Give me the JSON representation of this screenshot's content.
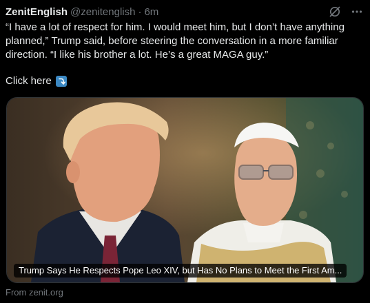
{
  "tweet": {
    "author_name": "ZenitEnglish",
    "handle": "@zenitenglish",
    "separator": "·",
    "time": "6m",
    "text": "“I have a lot of respect for him. I would meet him, but I don’t have anything planned,” Trump said, before steering the conversation in a more familiar direction. “I like his brother a lot. He’s a great MAGA guy.”",
    "link_text": "Click here",
    "link_icon": "right-arrow-curving-down-emoji",
    "icons": [
      "grok-icon",
      "more-icon"
    ]
  },
  "card": {
    "headline": "Trump Says He Respects Pope Leo XIV, but Has No Plans to Meet the First Am...",
    "source": "From zenit.org"
  },
  "colors": {
    "background": "#000000",
    "text": "#e7e9ea",
    "muted": "#71767b",
    "border": "#2f3336",
    "emoji_blue": "#3b88c3"
  }
}
